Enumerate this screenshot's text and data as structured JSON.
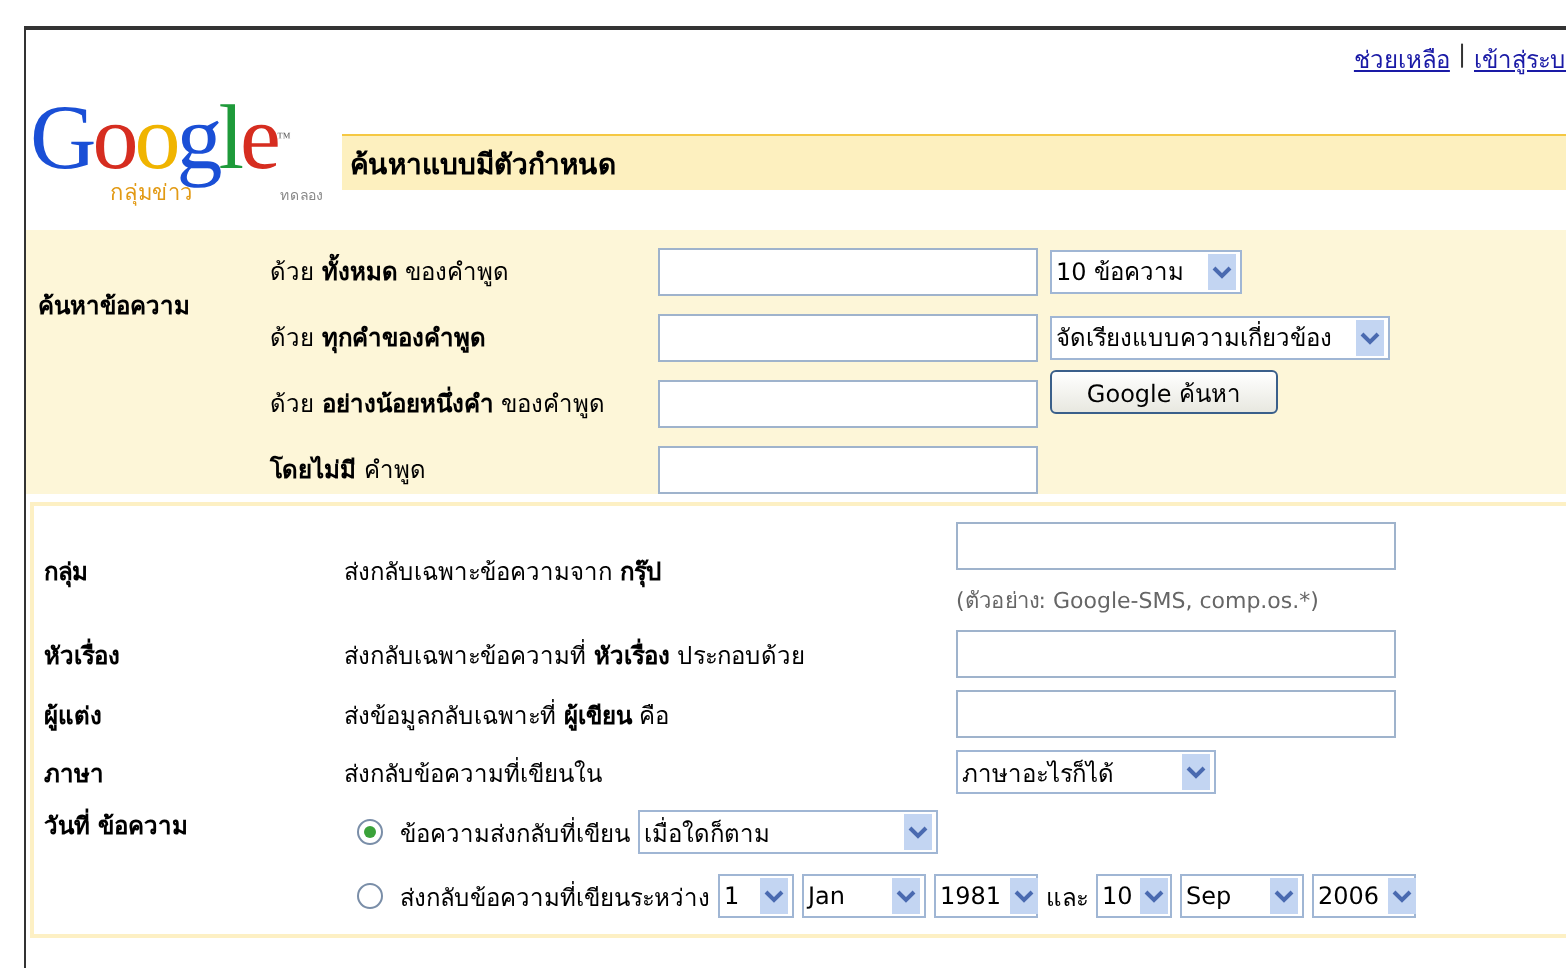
{
  "links": [
    {
      "label": "ช่วยเหลือ"
    },
    {
      "label": "เข้าสู่ระบ"
    }
  ],
  "link_separator": "|",
  "logo": {
    "wordmark": "Google",
    "trademark": "™",
    "product": "กลุ่มข่าว",
    "badge": "ทดลอง"
  },
  "page_title": "ค้นหาแบบมีตัวกำหนด",
  "find_messages": {
    "label": "ค้นหาข้อความ",
    "rows": [
      {
        "label": "ด้วย **ทั้งหมด** ของคำพูด"
      },
      {
        "label": "ด้วย **ทุกคำของคำพูด**"
      },
      {
        "label": "ด้วย **อย่างน้อยหนึ่งคำ** ของคำพูด"
      },
      {
        "label": "**โดยไม่มี** คำพูด"
      }
    ],
    "results_per_page": "10 ข้อความ",
    "sort": "จัดเรียงแบบความเกี่ยวข้อง",
    "search_button": "Google ค้นหา"
  },
  "filters": [
    {
      "label": "กลุ่ม",
      "description": "ส่งกลับเฉพาะข้อความจาก **กรุ๊ป**",
      "kind": "text",
      "hint": "(ตัวอย่าง: Google-SMS, comp.os.*)"
    },
    {
      "label": "หัวเรื่อง",
      "description": "ส่งกลับเฉพาะข้อความที่ **หัวเรื่อง** ประกอบด้วย",
      "kind": "text"
    },
    {
      "label": "ผู้แต่ง",
      "description": "ส่งข้อมูลกลับเฉพาะที่ **ผู้เขียน** คือ",
      "kind": "text"
    },
    {
      "label": "ภาษา",
      "description": "ส่งกลับข้อความที่เขียนใน",
      "kind": "select",
      "value": "ภาษาอะไรก็ได้"
    }
  ],
  "date": {
    "label": "วันที่ ข้อความ",
    "options": [
      {
        "kind": "any",
        "label": "ข้อความส่งกลับที่เขียน",
        "selected": true,
        "value": "เมื่อใดก็ตาม"
      },
      {
        "kind": "range",
        "label": "ส่งกลับข้อความที่เขียนระหว่าง",
        "selected": false,
        "from": [
          "1",
          "Jan",
          "1981"
        ],
        "joiner": "และ",
        "to": [
          "10",
          "Sep",
          "2006"
        ]
      }
    ]
  }
}
